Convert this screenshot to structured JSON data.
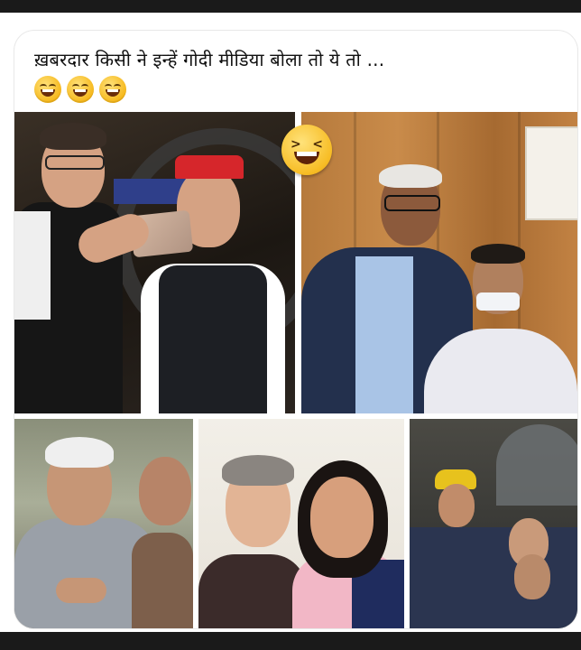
{
  "post": {
    "caption": "ख़बरदार किसी ने इन्हें गोदी मीडिया बोला तो ये तो ...",
    "reaction_emojis": [
      "grinning-face-icon",
      "grinning-face-icon",
      "grinning-face-icon"
    ],
    "overlay_emoji": "laughing-squinting-face-icon"
  },
  "collage": {
    "photos": [
      {
        "id": "top-left",
        "description_icon": "selfie-photo"
      },
      {
        "id": "top-right",
        "description_icon": "pose-photo"
      },
      {
        "id": "bottom-left",
        "description_icon": "crowd-photo"
      },
      {
        "id": "bottom-center",
        "description_icon": "portrait-photo"
      },
      {
        "id": "bottom-right",
        "description_icon": "crowd-photo"
      }
    ]
  },
  "colors": {
    "card_background": "#ffffff",
    "frame_dark": "#1a1a1a",
    "emoji_yellow": "#f6b81c"
  }
}
